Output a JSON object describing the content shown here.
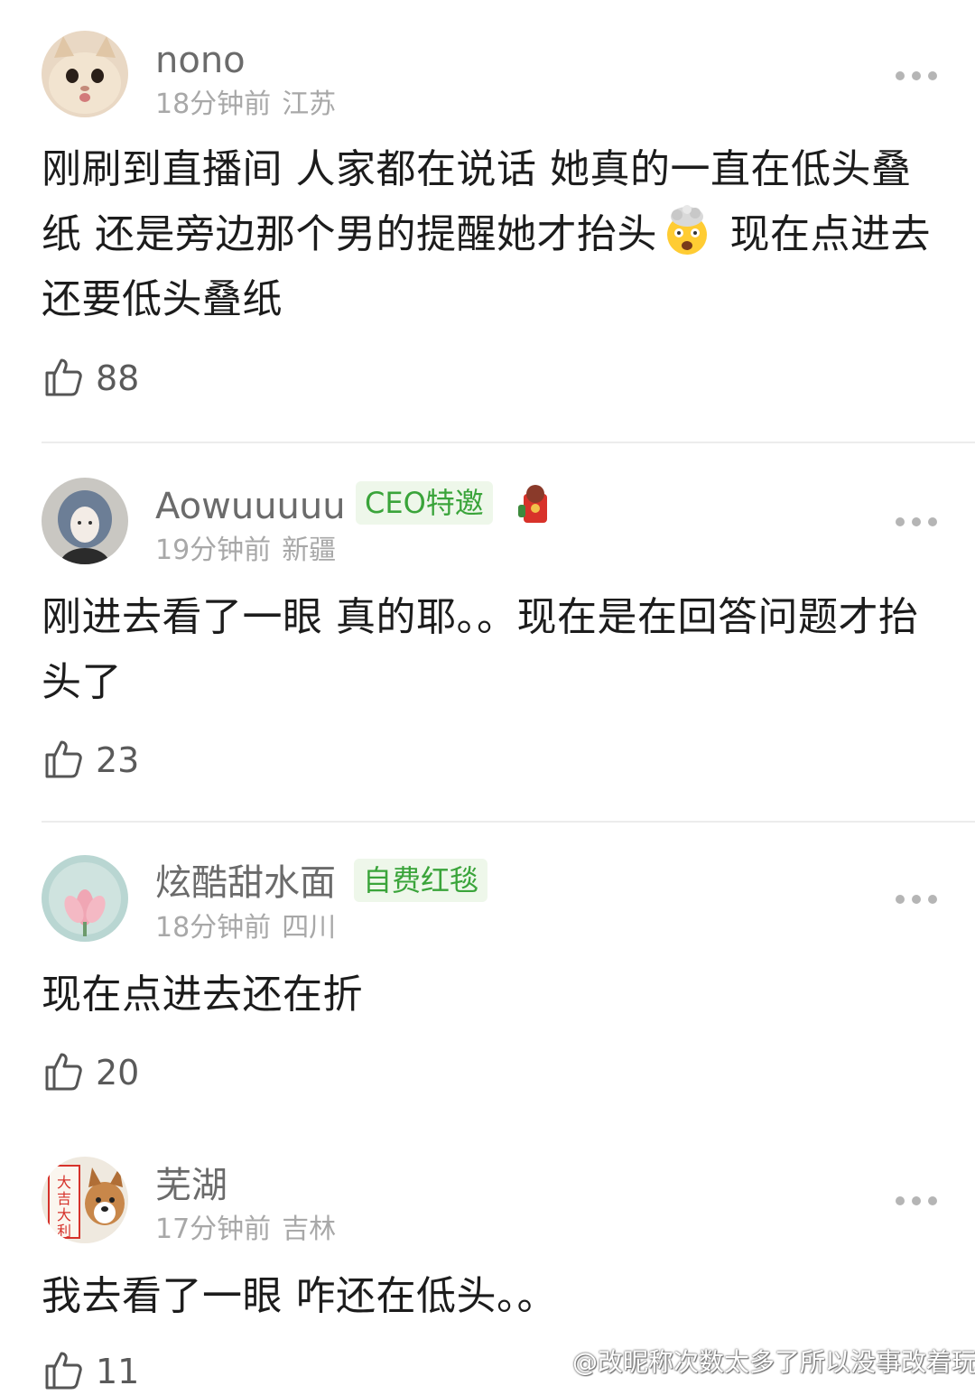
{
  "comments": [
    {
      "username": "nono",
      "time": "18分钟前",
      "location": "江苏",
      "text_before_emoji": "刚刷到直播间 人家都在说话 她真的一直在低头叠纸 还是旁边那个男的提醒她才抬头",
      "text_after_emoji": " 现在点进去还要低头叠纸",
      "emoji": "exploding-head-emoji",
      "likes": "88"
    },
    {
      "username": "Aowuuuuu",
      "badge": "CEO特邀",
      "time": "19分钟前",
      "location": "新疆",
      "text": "刚进去看了一眼 真的耶。。现在是在回答问题才抬头了",
      "likes": "23"
    },
    {
      "username": "炫酷甜水面",
      "badge": "自费红毯",
      "time": "18分钟前",
      "location": "四川",
      "text": "现在点进去还在折",
      "likes": "20"
    },
    {
      "username": "芜湖",
      "time": "17分钟前",
      "location": "吉林",
      "text": "我去看了一眼 咋还在低头。。",
      "likes": "11",
      "avatar_text": "大吉大利"
    }
  ],
  "watermark": "@改昵称次数太多了所以没事改着玩",
  "colors": {
    "badge_bg": "#eef7ea",
    "badge_text": "#3aa43a",
    "username": "#6b6b6b",
    "meta": "#a8a8a8"
  }
}
